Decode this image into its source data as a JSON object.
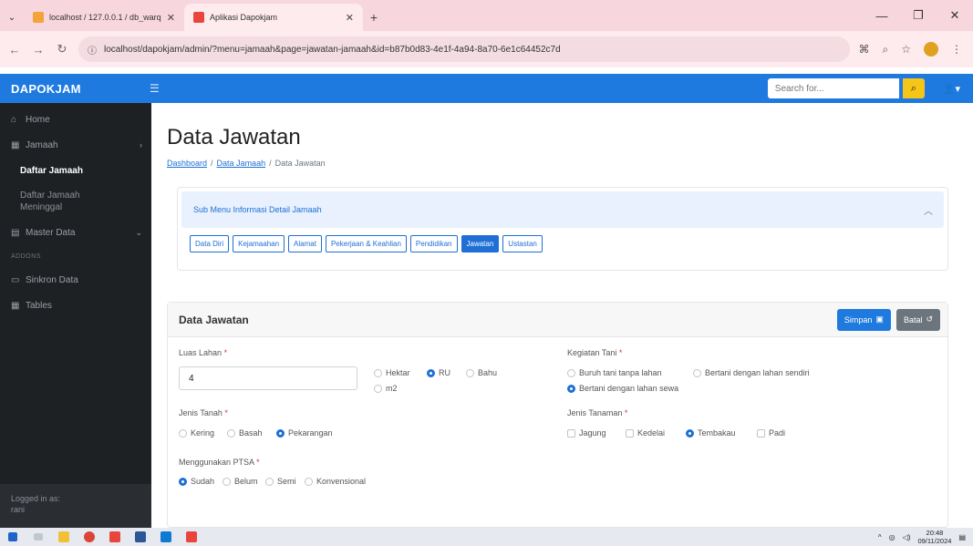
{
  "browser": {
    "tabs": [
      {
        "title": "localhost / 127.0.0.1 / db_warq",
        "close": "✕"
      },
      {
        "title": "Aplikasi Dapokjam",
        "close": "✕"
      }
    ],
    "new_tab": "+",
    "url": "localhost/dapokjam/admin/?menu=jamaah&page=jawatan-jamaah&id=b87b0d83-4e1f-4a94-8a70-6e1c64452c7d"
  },
  "app": {
    "brand": "DAPOKJAM",
    "search_placeholder": "Search for..."
  },
  "sidebar": {
    "home": "Home",
    "jamaah": "Jamaah",
    "daftar_jamaah": "Daftar Jamaah",
    "daftar_jamaah_meninggal": "Daftar Jamaah Meninggal",
    "master_data": "Master Data",
    "heading_addons": "ADDONS",
    "sinkron_data": "Sinkron Data",
    "tables": "Tables",
    "logged_in_label": "Logged in as:",
    "logged_in_user": "rani"
  },
  "page": {
    "title": "Data Jawatan",
    "breadcrumb": [
      "Dashboard",
      "Data Jamaah",
      "Data Jawatan"
    ],
    "breadcrumb_sep": "/"
  },
  "submenu": {
    "title": "Sub Menu Informasi Detail Jamaah",
    "pills": [
      "Data Diri",
      "Kejamaahan",
      "Alamat",
      "Pekerjaan & Keahlian",
      "Pendidikan",
      "Jawatan",
      "Ustastan"
    ]
  },
  "form": {
    "title": "Data Jawatan",
    "save_label": "Simpan",
    "cancel_label": "Batal",
    "luas_lahan": {
      "label": "Luas Lahan",
      "value": "4",
      "units": [
        "Hektar",
        "RU",
        "Bahu",
        "m2"
      ],
      "selected": "RU"
    },
    "jenis_tanah": {
      "label": "Jenis Tanah",
      "options": [
        "Kering",
        "Basah",
        "Pekarangan"
      ],
      "selected": "Pekarangan"
    },
    "ptsa": {
      "label": "Menggunakan PTSA",
      "options": [
        "Sudah",
        "Belum",
        "Semi",
        "Konvensional"
      ],
      "selected": "Sudah"
    },
    "kegiatan_tani": {
      "label": "Kegiatan Tani",
      "options": [
        "Buruh tani tanpa lahan",
        "Bertani dengan lahan sendiri",
        "Bertani dengan lahan sewa"
      ],
      "selected": "Bertani dengan lahan sewa"
    },
    "jenis_tanaman": {
      "label": "Jenis Tanaman",
      "options": [
        "Jagung",
        "Kedelai",
        "Tembakau",
        "Padi"
      ],
      "selected": "Tembakau"
    },
    "required_mark": "*"
  },
  "taskbar": {
    "time": "20:48",
    "date": "09/11/2024"
  },
  "colors": {
    "primary": "#1f7ae0",
    "sidebar_bg": "#1e2124",
    "accent_yellow": "#f5c518"
  }
}
